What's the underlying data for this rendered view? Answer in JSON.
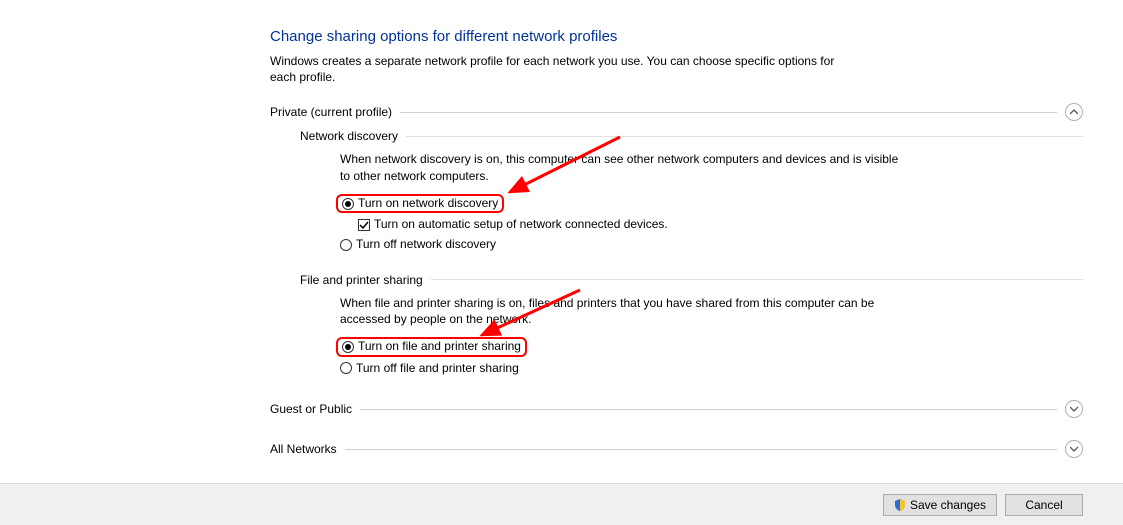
{
  "title": "Change sharing options for different network profiles",
  "description": "Windows creates a separate network profile for each network you use. You can choose specific options for each profile.",
  "profiles": {
    "private": {
      "label": "Private (current profile)",
      "network_discovery": {
        "heading": "Network discovery",
        "description": "When network discovery is on, this computer can see other network computers and devices and is visible to other network computers.",
        "radio_on": "Turn on network discovery",
        "checkbox_auto": "Turn on automatic setup of network connected devices.",
        "radio_off": "Turn off network discovery"
      },
      "file_printer": {
        "heading": "File and printer sharing",
        "description": "When file and printer sharing is on, files and printers that you have shared from this computer can be accessed by people on the network.",
        "radio_on": "Turn on file and printer sharing",
        "radio_off": "Turn off file and printer sharing"
      }
    },
    "guest_public": {
      "label": "Guest or Public"
    },
    "all_networks": {
      "label": "All Networks"
    }
  },
  "footer": {
    "save": "Save changes",
    "cancel": "Cancel"
  }
}
